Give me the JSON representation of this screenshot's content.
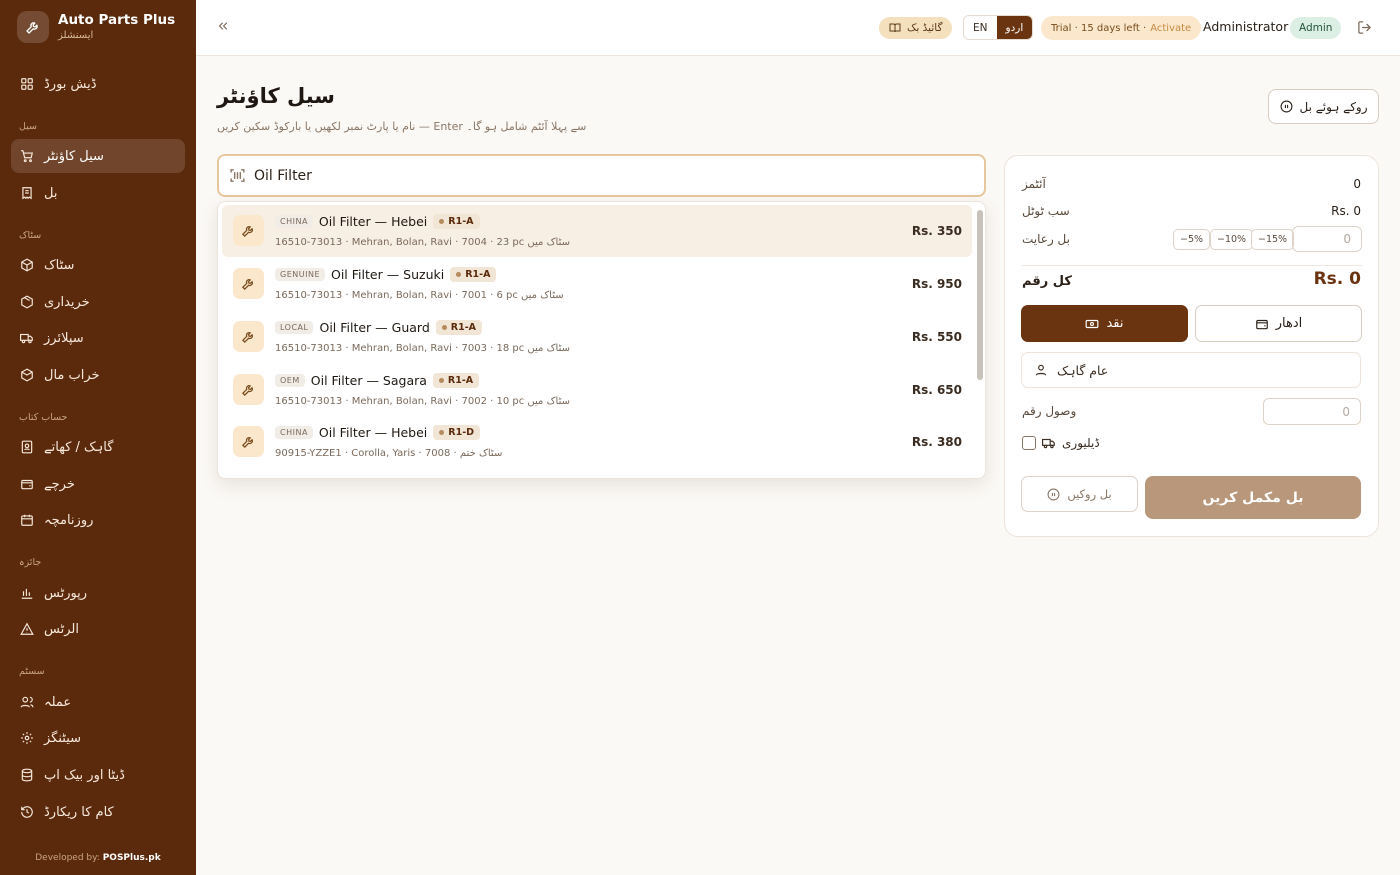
{
  "brand": {
    "name": "Auto Parts Plus",
    "subtitle": "ایسنشلز"
  },
  "sidebar": {
    "dashboard": "ڈیش بورڈ",
    "sections": {
      "sale": "سیل",
      "stock": "سٹاک",
      "accounts": "حساب کتاب",
      "review": "جائزہ",
      "system": "سسٹم"
    },
    "items": {
      "sale_counter": "سیل کاؤنٹر",
      "bill": "بل",
      "stock": "سٹاک",
      "purchase": "خریداری",
      "suppliers": "سپلائرز",
      "damaged": "خراب مال",
      "customers": "گاہک / کھاتے",
      "expenses": "خرچے",
      "daybook": "روزنامچہ",
      "reports": "رپورٹس",
      "alerts": "الرٹس",
      "staff": "عملہ",
      "settings": "سیٹنگز",
      "backup": "ڈیٹا اور بیک اپ",
      "activity": "کام کا ریکارڈ"
    },
    "footer_prefix": "Developed by:",
    "footer_brand": "POSPlus.pk"
  },
  "topbar": {
    "guidebook": "گائیڈ بک",
    "lang_en": "EN",
    "lang_ur": "اردو",
    "trial_text": "Trial · 15 days left ·",
    "trial_action": "Activate",
    "user": "Administrator",
    "role": "Admin"
  },
  "page": {
    "title": "سیل کاؤنٹر",
    "subtitle": "نام یا پارٹ نمبر لکھیں یا بارکوڈ سکین کریں — Enter سے پہلا آئٹم شامل ہو گا۔",
    "held_bills": "روکے ہوئے بل"
  },
  "search": {
    "value": "Oil Filter"
  },
  "results": [
    {
      "tag": "CHINA",
      "name": "Oil Filter — Hebei",
      "rack": "R1-A",
      "details": "16510-73013 · Mehran, Bolan, Ravi · 7004 · 23 pc سٹاک میں",
      "price": "Rs. 350"
    },
    {
      "tag": "GENUINE",
      "name": "Oil Filter — Suzuki",
      "rack": "R1-A",
      "details": "16510-73013 · Mehran, Bolan, Ravi · 7001 · 6 pc سٹاک میں",
      "price": "Rs. 950"
    },
    {
      "tag": "LOCAL",
      "name": "Oil Filter — Guard",
      "rack": "R1-A",
      "details": "16510-73013 · Mehran, Bolan, Ravi · 7003 · 18 pc سٹاک میں",
      "price": "Rs. 550"
    },
    {
      "tag": "OEM",
      "name": "Oil Filter — Sagara",
      "rack": "R1-A",
      "details": "16510-73013 · Mehran, Bolan, Ravi · 7002 · 10 pc سٹاک میں",
      "price": "Rs. 650"
    },
    {
      "tag": "CHINA",
      "name": "Oil Filter — Hebei",
      "rack": "R1-D",
      "details": "90915-YZZE1 · Corolla, Yaris · 7008 · سٹاک ختم",
      "price": "Rs. 380"
    }
  ],
  "summary": {
    "items_label": "آئٹمز",
    "items_value": "0",
    "subtotal_label": "سب ٹوٹل",
    "subtotal_value": "Rs. 0",
    "discount_label": "بل رعایت",
    "disc_5": "−5%",
    "disc_10": "−10%",
    "disc_15": "−15%",
    "discount_value": "0",
    "total_label": "کل رقم",
    "total_value": "Rs. 0",
    "cash": "نقد",
    "credit": "ادھار",
    "customer": "عام گاہک",
    "received_label": "وصول رقم",
    "received_value": "0",
    "delivery": "ڈیلیوری",
    "hold": "بل روکیں",
    "complete": "بل مکمل کریں"
  }
}
